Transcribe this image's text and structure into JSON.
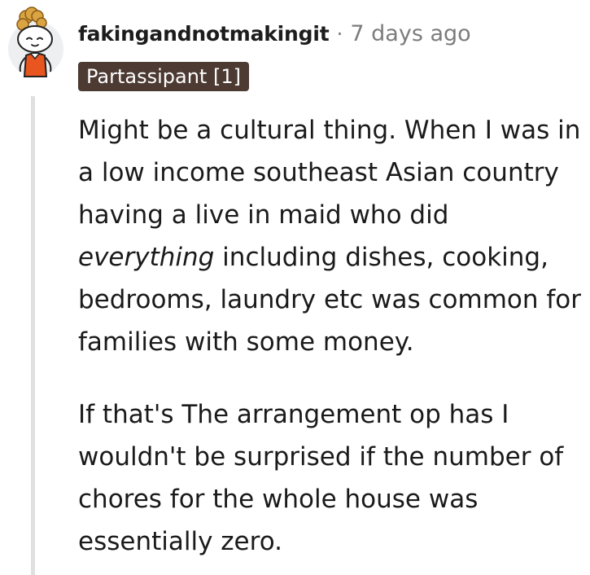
{
  "comment": {
    "author": "fakingandnotmakingit",
    "separator": "·",
    "timestamp": "7 days ago",
    "flair": "Partassipant [1]",
    "avatar_icon": "snoo-avatar-icon",
    "paragraphs": [
      {
        "before": "Might be a cultural thing. When I was in a low income southeast Asian country having a live in maid who did ",
        "emphasis": "everything",
        "after": " including dishes, cooking, bedrooms, laundry etc was common for families with some money."
      },
      {
        "text": "If that's The arrangement op has I wouldn't be surprised if the number of chores for the whole house was essentially zero."
      }
    ]
  },
  "colors": {
    "flair_bg": "#4c3a33",
    "flair_text": "#ffffff",
    "meta_text": "#7c7c7c",
    "body_text": "#1a1a1b",
    "thread_line": "#e0e0e0",
    "avatar_bg": "#edeff1",
    "avatar_shirt": "#e8551e"
  }
}
